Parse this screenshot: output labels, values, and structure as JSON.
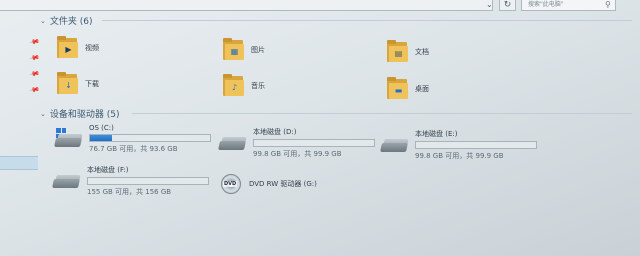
{
  "toolbar": {
    "dropdown_icon": "chevron-down-icon",
    "dropdown_glyph": "⌄",
    "refresh_icon": "refresh-icon",
    "refresh_glyph": "↻",
    "search_placeholder": "搜索\"此电脑\"",
    "search_icon": "search-icon",
    "search_glyph": "⚲"
  },
  "groups": {
    "folders": {
      "title": "文件夹 (6)",
      "chevron": "⌄"
    },
    "devices": {
      "title": "设备和驱动器 (5)",
      "chevron": "⌄"
    }
  },
  "folders": [
    {
      "label": "视频",
      "icon": "video-folder-icon",
      "overlay": "▶",
      "overlay_color": "#1b3b66"
    },
    {
      "label": "图片",
      "icon": "pictures-folder-icon",
      "overlay": "▦",
      "overlay_color": "#2b6cb0"
    },
    {
      "label": "文档",
      "icon": "documents-folder-icon",
      "overlay": "▤",
      "overlay_color": "#4a5560"
    },
    {
      "label": "下载",
      "icon": "downloads-folder-icon",
      "overlay": "↓",
      "overlay_color": "#1e6fd0"
    },
    {
      "label": "音乐",
      "icon": "music-folder-icon",
      "overlay": "♪",
      "overlay_color": "#1e6fd0"
    },
    {
      "label": "桌面",
      "icon": "desktop-folder-icon",
      "overlay": "▬",
      "overlay_color": "#1e6fd0"
    }
  ],
  "drives": [
    {
      "name": "OS (C:)",
      "free": "76.7 GB 可用，共 93.6 GB",
      "used_fraction": 0.18,
      "icon": "windows-drive-icon"
    },
    {
      "name": "本地磁盘 (D:)",
      "free": "99.8 GB 可用，共 99.9 GB",
      "used_fraction": 0.0,
      "icon": "hard-drive-icon"
    },
    {
      "name": "本地磁盘 (E:)",
      "free": "99.8 GB 可用，共 99.9 GB",
      "used_fraction": 0.0,
      "icon": "hard-drive-icon"
    },
    {
      "name": "本地磁盘 (F:)",
      "free": "155 GB 可用，共 156 GB",
      "used_fraction": 0.0,
      "icon": "hard-drive-icon"
    }
  ],
  "dvd": {
    "name": "DVD RW 驱动器 (G:)",
    "badge": "DVD",
    "icon": "dvd-drive-icon"
  },
  "nav_pins": {
    "icon": "pin-icon",
    "glyph": "📌"
  }
}
